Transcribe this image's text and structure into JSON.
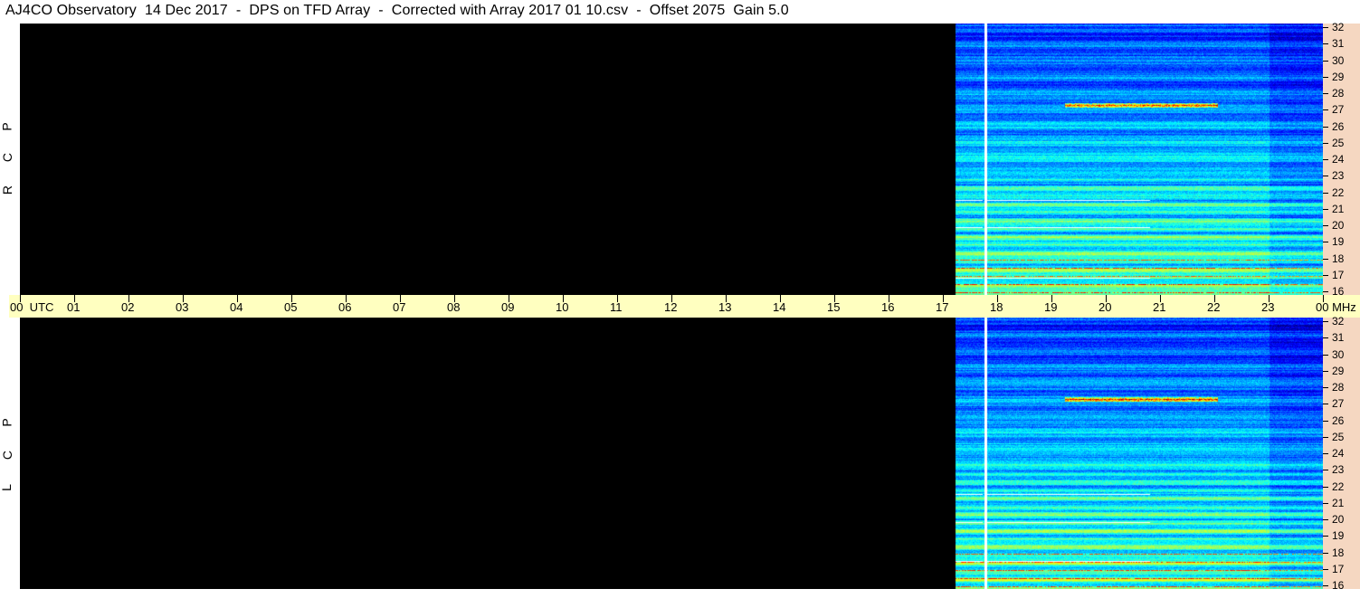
{
  "title": "AJ4CO Observatory  14 Dec 2017  -  DPS on TFD Array  -  Corrected with Array 2017 01 10.csv  -  Offset 2075  Gain 5.0",
  "panels": [
    {
      "polarization": "R C P",
      "letters": [
        "P",
        "C",
        "R"
      ]
    },
    {
      "polarization": "L C P",
      "letters": [
        "P",
        "C",
        "L"
      ]
    }
  ],
  "time_axis": {
    "labels": [
      "00  UTC",
      "01",
      "02",
      "03",
      "04",
      "05",
      "06",
      "07",
      "08",
      "09",
      "10",
      "11",
      "12",
      "13",
      "14",
      "15",
      "16",
      "17",
      "18",
      "19",
      "20",
      "21",
      "22",
      "23",
      "00 MHz"
    ]
  },
  "freq_axis": {
    "labels": [
      "32",
      "31",
      "30",
      "29",
      "28",
      "27",
      "26",
      "25",
      "24",
      "23",
      "22",
      "21",
      "20",
      "19",
      "18",
      "17",
      "16"
    ]
  },
  "colors": {
    "background": "#000000",
    "time_bar": "#ffffc0",
    "freq_bar": "#f5d7c1",
    "spectrogram_base": "#1a8cff"
  },
  "data_start_hour": 17.23
}
